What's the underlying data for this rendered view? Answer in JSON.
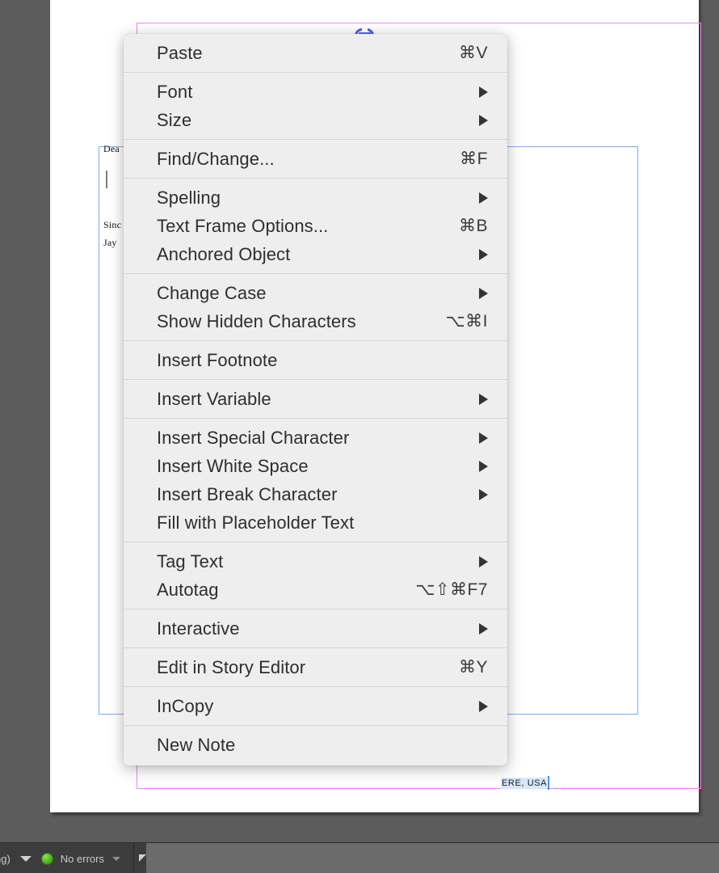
{
  "document": {
    "body_lines": [
      "Dea",
      "Sinc",
      "Jay"
    ],
    "signature_line": "ERE, USA",
    "caret_visible": true
  },
  "status_bar": {
    "zoom_label": "ng)",
    "errors_label": "No errors",
    "error_indicator_color": "#3fa814"
  },
  "context_menu": {
    "background_color": "#eeeeee",
    "text_color": "#2e2e2e",
    "groups": [
      {
        "items": [
          {
            "label": "Paste",
            "shortcut": "⌘V",
            "submenu": false
          }
        ]
      },
      {
        "items": [
          {
            "label": "Font",
            "shortcut": "",
            "submenu": true
          },
          {
            "label": "Size",
            "shortcut": "",
            "submenu": true
          }
        ]
      },
      {
        "items": [
          {
            "label": "Find/Change...",
            "shortcut": "⌘F",
            "submenu": false
          }
        ]
      },
      {
        "items": [
          {
            "label": "Spelling",
            "shortcut": "",
            "submenu": true
          },
          {
            "label": "Text Frame Options...",
            "shortcut": "⌘B",
            "submenu": false
          },
          {
            "label": "Anchored Object",
            "shortcut": "",
            "submenu": true
          }
        ]
      },
      {
        "items": [
          {
            "label": "Change Case",
            "shortcut": "",
            "submenu": true
          },
          {
            "label": "Show Hidden Characters",
            "shortcut": "⌥⌘I",
            "submenu": false
          }
        ]
      },
      {
        "items": [
          {
            "label": "Insert Footnote",
            "shortcut": "",
            "submenu": false
          }
        ]
      },
      {
        "items": [
          {
            "label": "Insert Variable",
            "shortcut": "",
            "submenu": true
          }
        ]
      },
      {
        "items": [
          {
            "label": "Insert Special Character",
            "shortcut": "",
            "submenu": true
          },
          {
            "label": "Insert White Space",
            "shortcut": "",
            "submenu": true
          },
          {
            "label": "Insert Break Character",
            "shortcut": "",
            "submenu": true
          },
          {
            "label": "Fill with Placeholder Text",
            "shortcut": "",
            "submenu": false
          }
        ]
      },
      {
        "items": [
          {
            "label": "Tag Text",
            "shortcut": "",
            "submenu": true
          },
          {
            "label": "Autotag",
            "shortcut": "⌥⇧⌘F7",
            "submenu": false
          }
        ]
      },
      {
        "items": [
          {
            "label": "Interactive",
            "shortcut": "",
            "submenu": true
          }
        ]
      },
      {
        "items": [
          {
            "label": "Edit in Story Editor",
            "shortcut": "⌘Y",
            "submenu": false
          }
        ]
      },
      {
        "items": [
          {
            "label": "InCopy",
            "shortcut": "",
            "submenu": true
          }
        ]
      },
      {
        "items": [
          {
            "label": "New Note",
            "shortcut": "",
            "submenu": false
          }
        ]
      }
    ]
  }
}
